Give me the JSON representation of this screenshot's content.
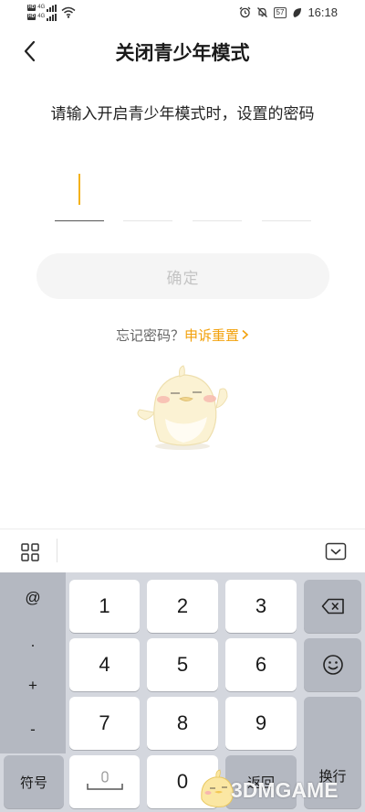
{
  "status_bar": {
    "sim1_label": "HD",
    "sim1_net": "4G",
    "sim2_label": "HD",
    "sim2_net": "4G",
    "battery": "57",
    "time": "16:18"
  },
  "header": {
    "title": "关闭青少年模式",
    "back_icon": "chevron-left-icon"
  },
  "prompt": "请输入开启青少年模式时，设置的密码",
  "password": {
    "length": 4,
    "filled": 0,
    "accent": "#f3b21a"
  },
  "confirm_button": "确定",
  "forgot": {
    "question": "忘记密码？",
    "link": "申诉重置",
    "link_icon": "chevron-right-icon",
    "link_color": "#f2a10c"
  },
  "keyboard": {
    "toolbar": {
      "left_icon": "grid-icon",
      "right_icon": "keyboard-hide-icon"
    },
    "symbols": [
      "@",
      ".",
      "+",
      "-"
    ],
    "digits": [
      "1",
      "2",
      "3",
      "4",
      "5",
      "6",
      "7",
      "8",
      "9",
      "0"
    ],
    "symbols_key": "符号",
    "space_icon": "microphone-icon",
    "return_key": "返回",
    "delete_icon": "backspace-icon",
    "emoji_icon": "smiley-icon",
    "newline_key": "换行"
  },
  "watermark": "3DMGAME"
}
